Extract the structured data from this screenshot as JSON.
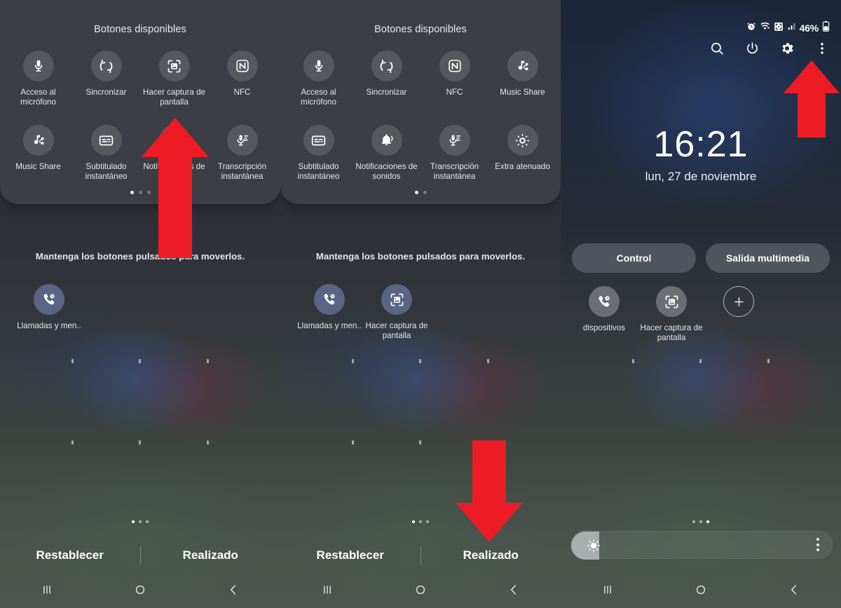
{
  "panels": [
    {
      "id": "edit-panel-page1",
      "sheet_title": "Botones disponibles",
      "available_buttons": [
        {
          "label": "Acceso al micrófono",
          "icon": "microphone-icon"
        },
        {
          "label": "Sincronizar",
          "icon": "sync-icon"
        },
        {
          "label": "Hacer captura de pantalla",
          "icon": "screenshot-icon"
        },
        {
          "label": "NFC",
          "icon": "nfc-icon"
        },
        {
          "label": "Music Share",
          "icon": "music-share-icon"
        },
        {
          "label": "Subtitulado instantáneo",
          "icon": "live-caption-icon"
        },
        {
          "label": "Notificaciones de sonidos",
          "icon": "sound-notification-icon"
        },
        {
          "label": "Transcripción instantánea",
          "icon": "live-transcribe-icon"
        }
      ],
      "page_dots": {
        "count": 3,
        "active": 0
      },
      "hint": "Mantenga los botones pulsados para moverlos.",
      "tray_buttons": [
        {
          "label": "Llamadas y men..",
          "icon": "call-message-continuity-icon"
        }
      ],
      "actions": {
        "reset": "Restablecer",
        "done": "Realizado"
      }
    },
    {
      "id": "edit-panel-page2",
      "sheet_title": "Botones disponibles",
      "available_buttons": [
        {
          "label": "Acceso al micrófono",
          "icon": "microphone-icon"
        },
        {
          "label": "Sincronizar",
          "icon": "sync-icon"
        },
        {
          "label": "NFC",
          "icon": "nfc-icon"
        },
        {
          "label": "Music Share",
          "icon": "music-share-icon"
        },
        {
          "label": "Subtitulado instantáneo",
          "icon": "live-caption-icon"
        },
        {
          "label": "Notificaciones de sonidos",
          "icon": "sound-notification-icon"
        },
        {
          "label": "Transcripción instantánea",
          "icon": "live-transcribe-icon"
        },
        {
          "label": "Extra atenuado",
          "icon": "extra-dim-icon"
        }
      ],
      "page_dots": {
        "count": 2,
        "active": 0
      },
      "hint": "Mantenga los botones pulsados para moverlos.",
      "tray_buttons": [
        {
          "label": "Llamadas y men..",
          "icon": "call-message-continuity-icon"
        },
        {
          "label": "Hacer captura de pantalla",
          "icon": "screenshot-icon"
        }
      ],
      "actions": {
        "reset": "Restablecer",
        "done": "Realizado"
      }
    }
  ],
  "quick_panel": {
    "status_bar": {
      "battery_percent": "46%",
      "icons": [
        "alarm-icon",
        "wifi-icon",
        "vpn-icon",
        "signal-icon",
        "battery-icon"
      ]
    },
    "header_icons": [
      "search-icon",
      "power-icon",
      "gear-icon",
      "more-options-icon"
    ],
    "clock": {
      "time": "16:21",
      "date": "lun, 27 de noviembre"
    },
    "pills": [
      {
        "label": "Control"
      },
      {
        "label": "Salida multimedia"
      }
    ],
    "quick_tiles": [
      {
        "label": "dispositivos",
        "icon": "call-message-continuity-icon"
      },
      {
        "label": "Hacer captura de pantalla",
        "icon": "screenshot-icon"
      },
      {
        "label": "",
        "icon": "add-icon"
      }
    ],
    "page_dots": {
      "count": 3,
      "active": 2
    },
    "brightness": {
      "icon": "brightness-icon",
      "menu_icon": "kebab-menu-icon",
      "level_percent": 6
    }
  },
  "navbar": {
    "recents": "recents-icon",
    "home": "home-icon",
    "back": "back-icon"
  },
  "annotations": {
    "accent_color": "#ed1c24",
    "arrows": [
      {
        "name": "arrow-up-screenshot-tile",
        "direction": "up"
      },
      {
        "name": "arrow-down-done-button",
        "direction": "down"
      },
      {
        "name": "arrow-up-more-options",
        "direction": "up"
      }
    ]
  }
}
